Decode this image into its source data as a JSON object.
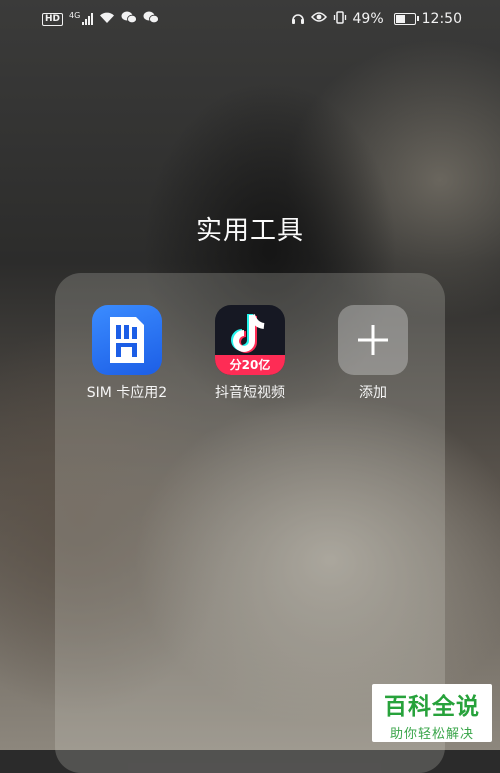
{
  "status_bar": {
    "hd_badge": "HD",
    "network_badge": "4G",
    "wifi_icon": "wifi-icon",
    "wechat_icons": [
      "wechat-icon",
      "wechat-icon"
    ],
    "headphones_icon": "headphones-icon",
    "eye_icon": "eye-comfort-icon",
    "vibrate_icon": "vibrate-icon",
    "battery_percent_text": "49%",
    "battery_level": 0.49,
    "time": "12:50"
  },
  "folder": {
    "title": "实用工具",
    "apps": [
      {
        "label": "SIM 卡应用2",
        "icon": "sim-card-icon",
        "color": "#2f7bff"
      },
      {
        "label": "抖音短视频",
        "icon": "douyin-icon",
        "banner": "分20亿",
        "color": "#161823"
      },
      {
        "label": "添加",
        "icon": "plus-icon"
      }
    ]
  },
  "watermark": {
    "main": "百科全说",
    "sub": "助你轻松解决",
    "color": "#27a23b"
  }
}
